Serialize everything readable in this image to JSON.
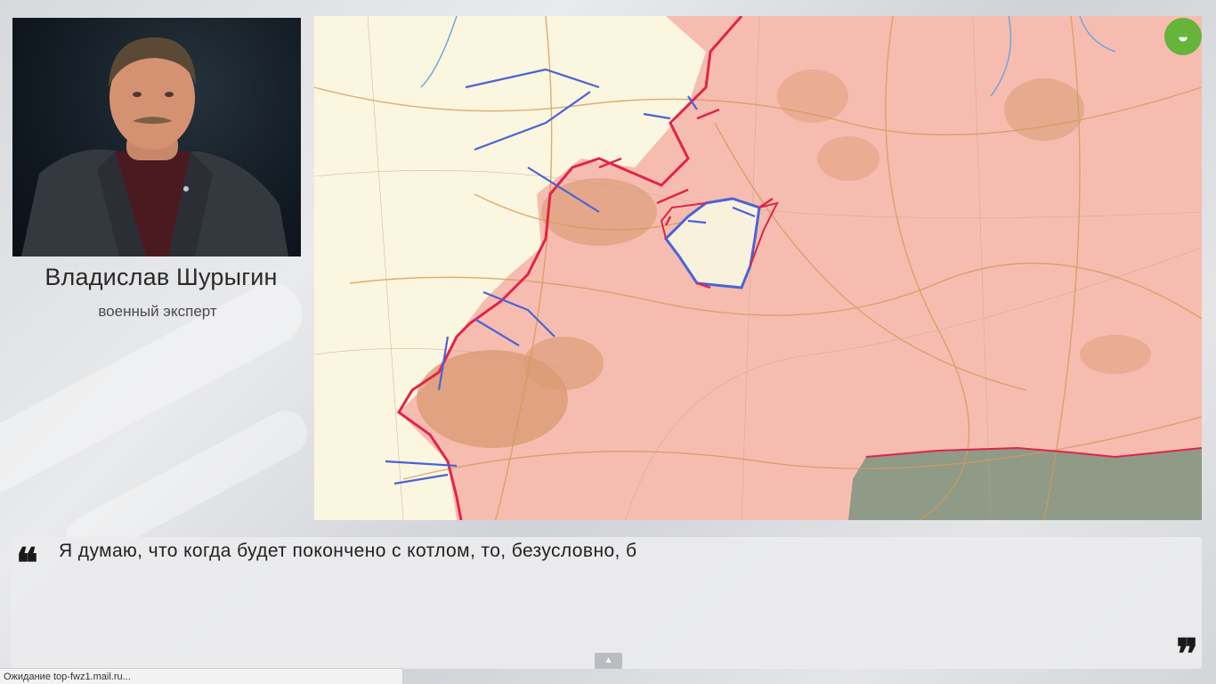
{
  "speaker": {
    "name": "Владислав Шурыгин",
    "role": "военный эксперт"
  },
  "quote": {
    "text": "Я думаю, что когда будет покончено с котлом, то, безусловно, б",
    "open_glyph": "❝",
    "close_glyph": "❞"
  },
  "status_bar": {
    "text": "Ожидание top-fwz1.mail.ru..."
  },
  "controls": {
    "scroll_up_glyph": "▲"
  },
  "colors": {
    "map_base": "#fbf6df",
    "occupied_zone": "#f5b9ad",
    "front_line": "#e0244a",
    "arrows_blue": "#4a63d6",
    "arrows_red": "#e0244a",
    "city_area": "#d99a72",
    "grey_region": "#8e9a86",
    "logo": "#66b43a"
  },
  "icons": {
    "logo": "channel-logo-icon"
  }
}
